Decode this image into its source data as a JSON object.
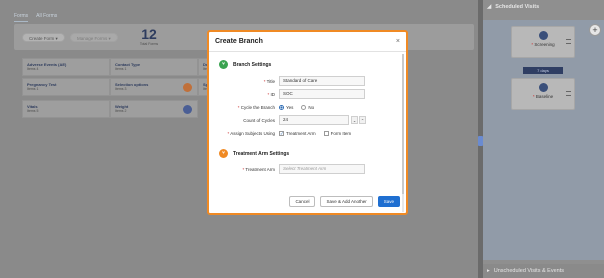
{
  "left": {
    "tabs": [
      "Forms",
      "All Forms"
    ],
    "create_form_label": "Create Form",
    "manage_forms_label": "Manage Forms",
    "total_forms_value": "12",
    "total_forms_label": "Total Forms",
    "cards": [
      {
        "title": "Adverse Events (AE)",
        "subtitle": "Items 4"
      },
      {
        "title": "Contact Type",
        "subtitle": "Items 1"
      },
      {
        "title": "Pregnancy Test",
        "subtitle": "Items 1"
      },
      {
        "title": "Selection options",
        "subtitle": "Items 3"
      },
      {
        "title": "Vitals",
        "subtitle": "Items 5"
      },
      {
        "title": "Weight",
        "subtitle": "Items 2"
      }
    ],
    "partial_cards": [
      "Dem",
      "Item",
      "Spe",
      "Item"
    ]
  },
  "right": {
    "scheduled_title": "Scheduled Visits",
    "unscheduled_title": "Unscheduled Visits & Events",
    "visits": [
      {
        "name": "Screening"
      },
      {
        "name": "Baseline"
      }
    ],
    "days_label": "7 days",
    "add_label": "+"
  },
  "modal": {
    "title": "Create Branch",
    "close": "×",
    "branch_settings": {
      "heading": "Branch Settings",
      "title_label": "Title",
      "title_value": "Standard of Care",
      "id_label": "ID",
      "id_value": "SOC",
      "cycle_label": "Cycle the Branch",
      "cycle_yes": "Yes",
      "cycle_no": "No",
      "count_label": "Count of Cycles",
      "count_value": "24",
      "assign_label": "Assign Subjects Using",
      "assign_treatment_arm": "Treatment Arm",
      "assign_form_item": "Form Item"
    },
    "treatment_settings": {
      "heading": "Treatment Arm Settings",
      "arm_label": "Treatment Arm",
      "arm_placeholder": "Select Treatment Arm"
    },
    "buttons": {
      "cancel": "Cancel",
      "save_add": "Save & Add Another",
      "save": "Save"
    }
  },
  "colors": {
    "accent": "#f08a24",
    "primary": "#1f6fd1",
    "section_green": "#3aa351",
    "section_orange": "#f08a24"
  }
}
